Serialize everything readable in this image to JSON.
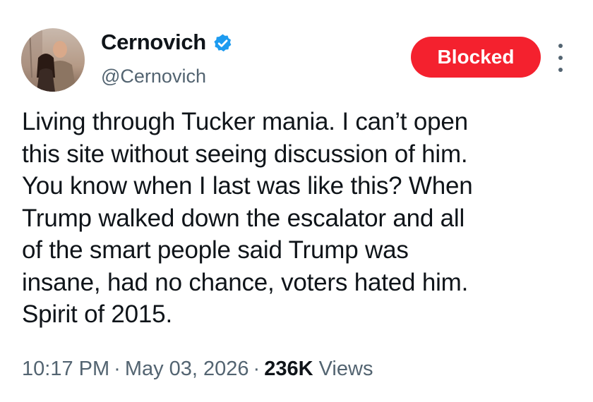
{
  "author": {
    "display_name": "Cernovich",
    "handle": "@Cernovich",
    "verified": true,
    "avatar_icon": "profile-photo"
  },
  "actions": {
    "blocked_label": "Blocked",
    "more_icon": "more-vertical-icon"
  },
  "tweet": {
    "text": "Living through Tucker mania. I can’t open\nthis site without seeing discussion of him.\nYou know when I last was like this? When\nTrump walked down the escalator and all\nof the smart people said Trump was\ninsane, had no chance, voters hated him.\nSpirit of 2015.",
    "time": "10:17 PM",
    "date": "May 03, 2026",
    "views_count": "236K",
    "views_label": "Views"
  },
  "colors": {
    "blocked_bg": "#f4212e",
    "verified_badge": "#1d9bf0",
    "secondary_text": "#536471",
    "primary_text": "#0f1419"
  }
}
